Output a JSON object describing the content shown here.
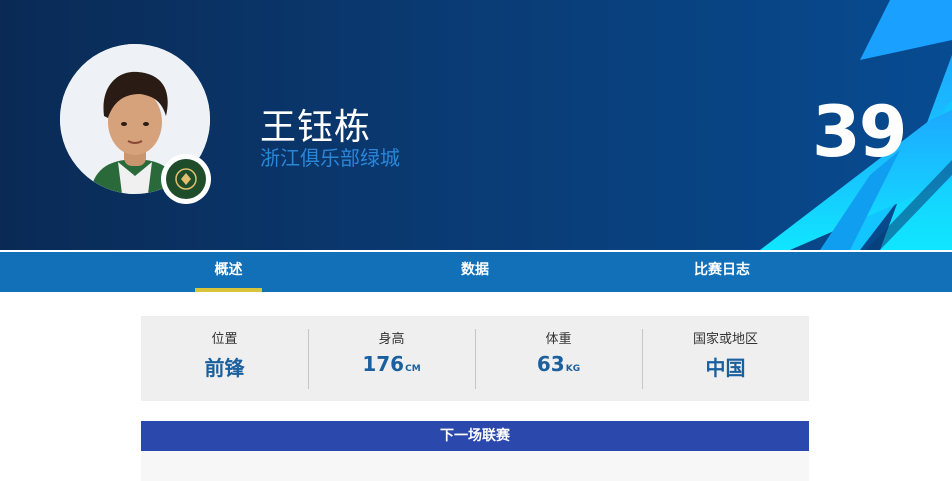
{
  "player": {
    "name": "王钰栋",
    "club": "浙江俱乐部绿城",
    "number": "39"
  },
  "tabs": [
    {
      "label": "概述",
      "active": true
    },
    {
      "label": "数据",
      "active": false
    },
    {
      "label": "比赛日志",
      "active": false
    }
  ],
  "stats": {
    "position": {
      "label": "位置",
      "value": "前锋"
    },
    "height": {
      "label": "身高",
      "value": "176",
      "unit": "CM"
    },
    "weight": {
      "label": "体重",
      "value": "63",
      "unit": "KG"
    },
    "nationality": {
      "label": "国家或地区",
      "value": "中国"
    }
  },
  "next_match": {
    "title": "下一场联赛"
  },
  "icons": {
    "avatar": "player-photo",
    "club_badge": "club-badge-icon"
  },
  "colors": {
    "hero_dark": "#0a2a55",
    "hero_accent": "#18c8ff",
    "tab_bar": "#1170b8",
    "tab_underline": "#d8c43a",
    "stat_value": "#1a5f9e",
    "section_bar": "#2b48ac"
  }
}
